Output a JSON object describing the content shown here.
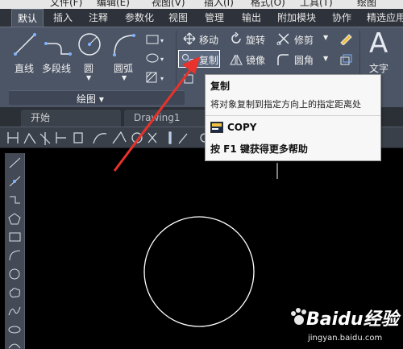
{
  "menubar": {
    "items": [
      "文件(F)",
      "编辑(E)",
      "视图(V)",
      "插入(I)",
      "格式(O)",
      "工具(T)",
      "绘图"
    ]
  },
  "ribbon_tabs": [
    "默认",
    "插入",
    "注释",
    "参数化",
    "视图",
    "管理",
    "输出",
    "附加模块",
    "协作",
    "精选应用"
  ],
  "active_tab": "默认",
  "draw_panel": {
    "title": "绘图 ▾",
    "tools": [
      "直线",
      "多段线",
      "圆",
      "圆弧"
    ]
  },
  "modify_panel": {
    "row1": [
      "移动",
      "旋转",
      "修剪"
    ],
    "row2": [
      "复制",
      "镜像",
      "圆角"
    ],
    "copy_highlighted": true
  },
  "annotation_panel": {
    "text_label": "文字"
  },
  "file_tabs": [
    "开始",
    "Drawing1"
  ],
  "tooltip": {
    "title": "复制",
    "description": "将对象复制到指定方向上的指定距离处",
    "command": "COPY",
    "help": "按 F1 键获得更多帮助"
  },
  "watermark": {
    "brand": "Baidu经验",
    "url": "jingyan.baidu.com"
  },
  "colors": {
    "ribbon_bg": "#4c5565",
    "tab_bar_bg": "#2e323a",
    "canvas_bg": "#000000",
    "arrow": "#e8322b",
    "tooltip_bg": "#f7f7f7",
    "highlight_box": "#ffffff"
  }
}
